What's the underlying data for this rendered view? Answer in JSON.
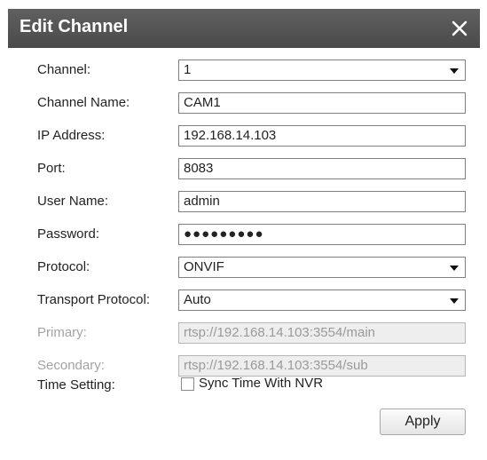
{
  "dialog": {
    "title": "Edit Channel",
    "close_icon": "close-icon"
  },
  "form": {
    "channel": {
      "label": "Channel:",
      "value": "1"
    },
    "channel_name": {
      "label": "Channel Name:",
      "value": "CAM1"
    },
    "ip_address": {
      "label": "IP Address:",
      "value": "192.168.14.103"
    },
    "port": {
      "label": "Port:",
      "value": "8083"
    },
    "user_name": {
      "label": "User Name:",
      "value": "admin"
    },
    "password": {
      "label": "Password:",
      "value": "●●●●●●●●●"
    },
    "protocol": {
      "label": "Protocol:",
      "value": "ONVIF"
    },
    "transport_protocol": {
      "label": "Transport Protocol:",
      "value": "Auto"
    },
    "primary": {
      "label": "Primary:",
      "value": "rtsp://192.168.14.103:3554/main"
    },
    "secondary": {
      "label": "Secondary:",
      "value": "rtsp://192.168.14.103:3554/sub"
    },
    "time_setting": {
      "label": "Time Setting:",
      "checkbox_label": "Sync Time With NVR",
      "checked": false
    }
  },
  "buttons": {
    "apply": "Apply"
  },
  "colors": {
    "titlebar": "#555555",
    "title_text": "#ffffff",
    "disabled_text": "#a3a3a3",
    "disabled_field_bg": "#eeeeee"
  }
}
